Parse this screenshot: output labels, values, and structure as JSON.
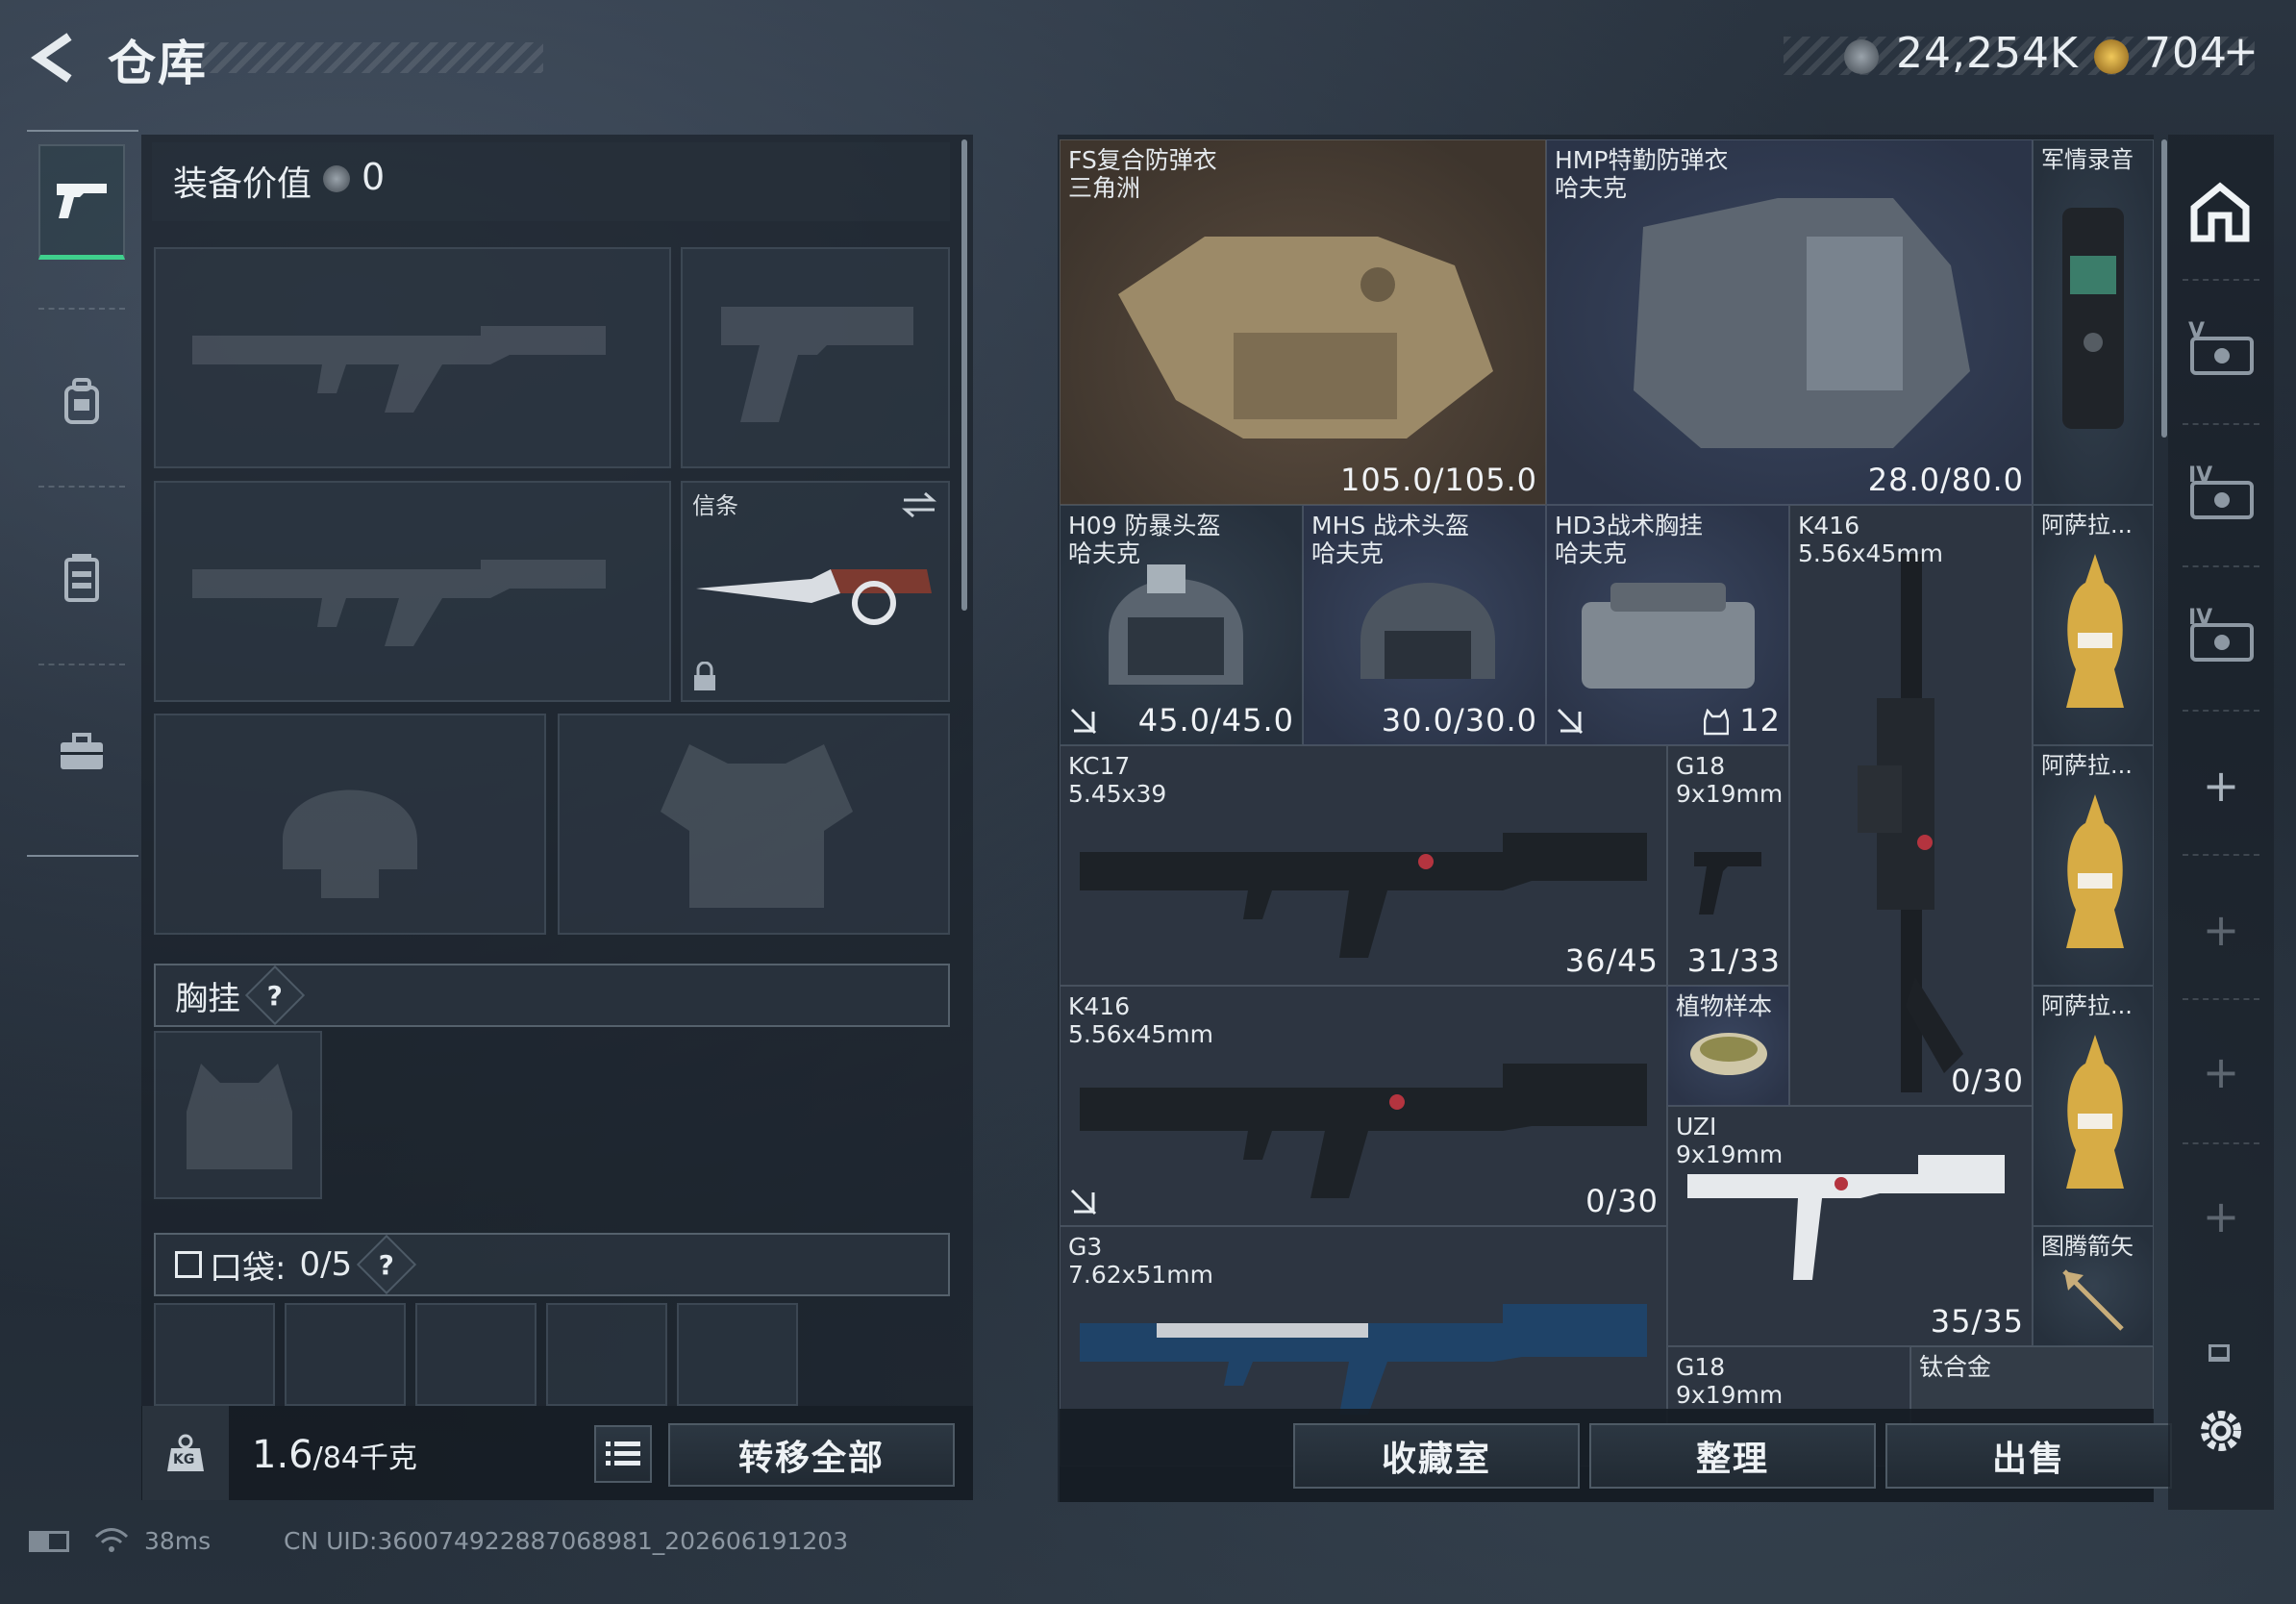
{
  "header": {
    "title": "仓库",
    "currency_main": "24,254K",
    "currency_premium": "704",
    "add_symbol": "+"
  },
  "left_panel": {
    "equip_value_label": "装备价值",
    "equip_value": "0",
    "melee_slot_label": "信条",
    "chest_rig_label": "胸挂",
    "pocket_label": "口袋:",
    "pocket_count": "0/5",
    "help_symbol": "?",
    "weight_value": "1.6",
    "weight_capacity": "/84千克",
    "weight_icon_text": "KG",
    "transfer_all": "转移全部"
  },
  "grid_items": [
    {
      "name": "FS复合防弹衣\n三角洲",
      "value": "105.0/105.0"
    },
    {
      "name": "HMP特勤防弹衣\n哈夫克",
      "value": "28.0/80.0"
    },
    {
      "name": "军情录音",
      "value": ""
    },
    {
      "name": "H09 防暴头盔\n哈夫克",
      "value": "45.0/45.0"
    },
    {
      "name": "MHS 战术头盔\n哈夫克",
      "value": "30.0/30.0"
    },
    {
      "name": "HD3战术胸挂\n哈夫克",
      "value": "12"
    },
    {
      "name": "K416\n5.56x45mm",
      "value": "0/30"
    },
    {
      "name": "阿萨拉...",
      "value": ""
    },
    {
      "name": "KC17\n5.45x39",
      "value": "36/45"
    },
    {
      "name": "G18\n9x19mm",
      "value": "31/33"
    },
    {
      "name": "阿萨拉...",
      "value": ""
    },
    {
      "name": "K416\n5.56x45mm",
      "value": "0/30"
    },
    {
      "name": "植物样本",
      "value": ""
    },
    {
      "name": "阿萨拉...",
      "value": ""
    },
    {
      "name": "UZI\n9x19mm",
      "value": "35/35"
    },
    {
      "name": "G3\n7.62x51mm",
      "value": ""
    },
    {
      "name": "图腾箭矢",
      "value": ""
    },
    {
      "name": "G18\n9x19mm",
      "value": ""
    },
    {
      "name": "钛合金",
      "value": ""
    }
  ],
  "bottom_buttons": {
    "collection": "收藏室",
    "organize": "整理",
    "sell": "出售"
  },
  "right_rail": {
    "tier_labels": [
      "V",
      "IV",
      "IV"
    ],
    "plus": "+"
  },
  "status_bar": {
    "ping": "38ms",
    "uid": "CN UID:360074922887068981_202606191203"
  },
  "colors": {
    "accent_green": "#3fd08d",
    "panel_bg": "#1a212a"
  }
}
